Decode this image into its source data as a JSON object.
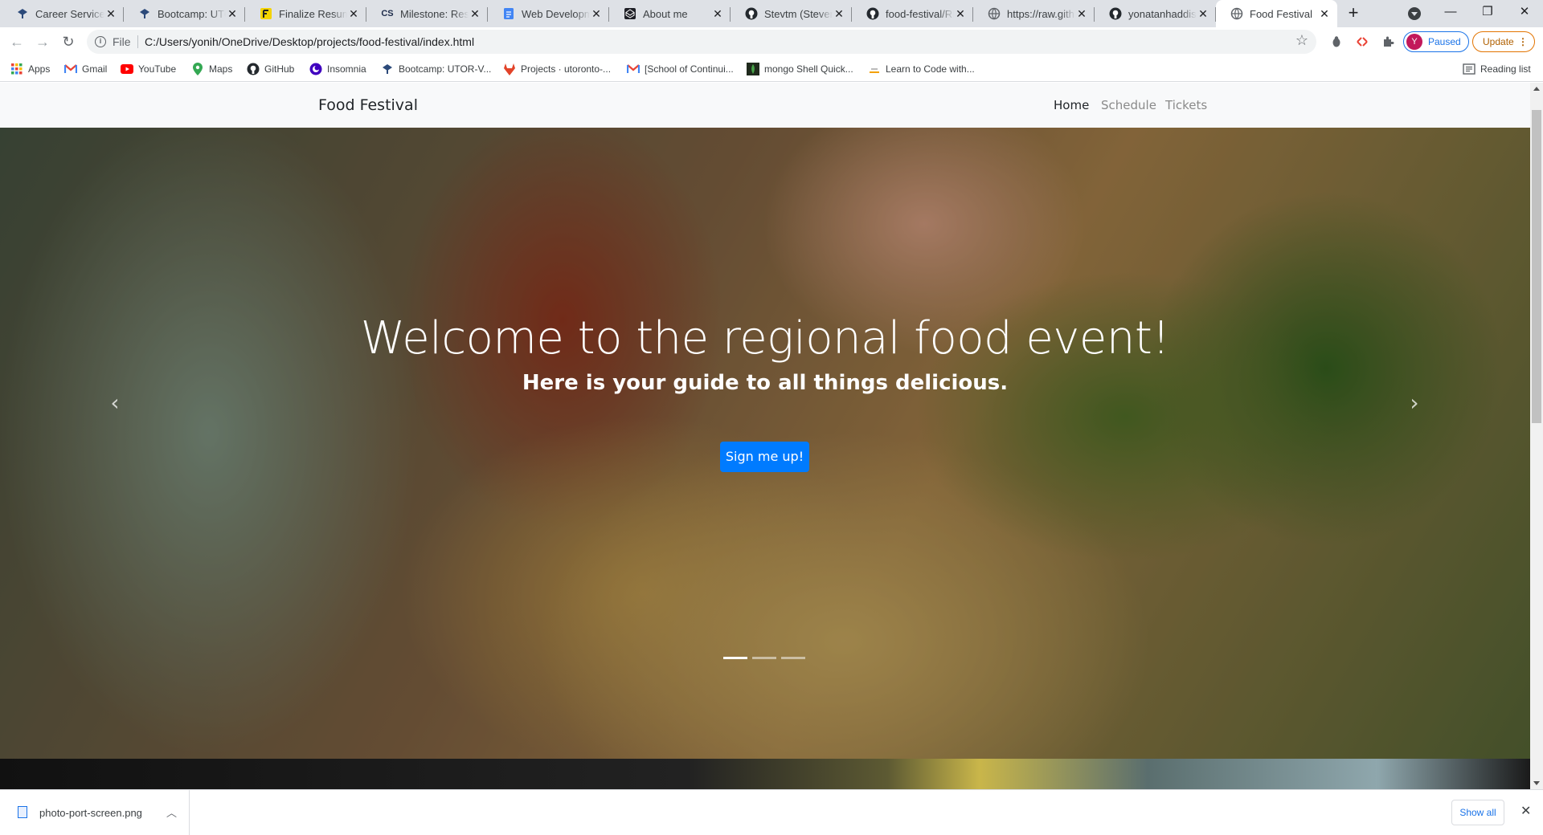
{
  "browser": {
    "tabs": [
      {
        "title": "Career Services",
        "icon": "bootcamp-logo-icon",
        "active": false
      },
      {
        "title": "Bootcamp: UTOR",
        "icon": "bootcamp-logo-icon",
        "active": false
      },
      {
        "title": "Finalize Resume",
        "icon": "resume-logo-icon",
        "active": false
      },
      {
        "title": "Milestone: Resu",
        "icon": "cs-logo-icon",
        "active": false
      },
      {
        "title": "Web Developme",
        "icon": "docs-icon",
        "active": false
      },
      {
        "title": "About me",
        "icon": "codepen-icon",
        "active": false
      },
      {
        "title": "Stevtm (Steven",
        "icon": "github-icon",
        "active": false
      },
      {
        "title": "food-festival/RE",
        "icon": "github-icon",
        "active": false
      },
      {
        "title": "https://raw.githu",
        "icon": "globe-icon",
        "active": false
      },
      {
        "title": "yonatanhaddish",
        "icon": "github-icon",
        "active": false
      },
      {
        "title": "Food Festival",
        "icon": "globe-icon",
        "active": true
      }
    ],
    "address": {
      "scheme_label": "File",
      "url": "C:/Users/yonih/OneDrive/Desktop/projects/food-festival/index.html"
    },
    "profile": {
      "initial": "Y",
      "status": "Paused"
    },
    "update_label": "Update",
    "bookmarks": [
      {
        "label": "Apps",
        "icon": "apps-grid-icon"
      },
      {
        "label": "Gmail",
        "icon": "gmail-icon"
      },
      {
        "label": "YouTube",
        "icon": "youtube-icon"
      },
      {
        "label": "Maps",
        "icon": "maps-pin-icon"
      },
      {
        "label": "GitHub",
        "icon": "github-icon"
      },
      {
        "label": "Insomnia",
        "icon": "insomnia-icon"
      },
      {
        "label": "Bootcamp: UTOR-V...",
        "icon": "bootcamp-logo-icon"
      },
      {
        "label": "Projects · utoronto-...",
        "icon": "gitlab-icon"
      },
      {
        "label": "[School of Continui...",
        "icon": "gmail-icon"
      },
      {
        "label": "mongo Shell Quick...",
        "icon": "mongo-icon"
      },
      {
        "label": "Learn to Code with...",
        "icon": "learn-code-icon"
      }
    ],
    "reading_list_label": "Reading list"
  },
  "site": {
    "brand": "Food Festival",
    "nav": [
      {
        "label": "Home",
        "current": true
      },
      {
        "label": "Schedule",
        "current": false
      },
      {
        "label": "Tickets",
        "current": false
      }
    ],
    "hero": {
      "title": "Welcome to the regional food event!",
      "subtitle": "Here is your guide to all things delicious.",
      "cta": "Sign me up!",
      "slide_count": 3,
      "active_slide": 1
    }
  },
  "downloads": {
    "file_name": "photo-port-screen.png",
    "show_all_label": "Show all"
  },
  "colors": {
    "primary_button": "#007bff",
    "navbar_bg": "#f8f9fa",
    "chrome_tabstrip": "#dee1e6"
  }
}
